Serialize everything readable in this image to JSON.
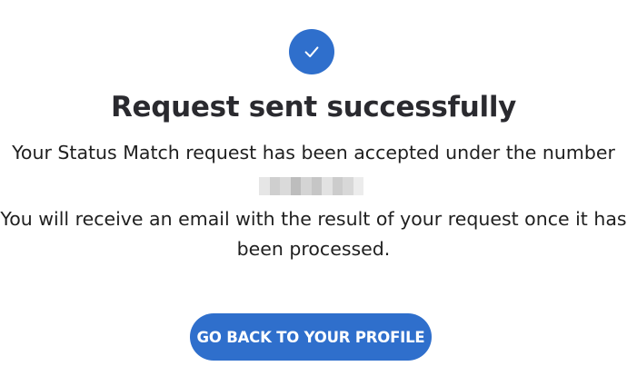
{
  "colors": {
    "accent": "#2f6fcc",
    "title": "#2a2a2f",
    "text": "#1f1f1f",
    "redacted_shades": [
      "#e6e6e6",
      "#cfcfcf",
      "#dadada",
      "#bdbdbd",
      "#d4d4d4",
      "#c6c6c6",
      "#e2e2e2",
      "#cccccc",
      "#d8d8d8",
      "#ececec"
    ]
  },
  "icon": "checkmark-icon",
  "title": "Request sent successfully",
  "message": {
    "accepted_line": "Your Status Match request has been accepted under the number",
    "request_number_redacted": true,
    "email_line_1": "You will receive an email with the result of your request once it has",
    "email_line_2": "been processed."
  },
  "button": {
    "label": "GO BACK TO YOUR PROFILE"
  }
}
